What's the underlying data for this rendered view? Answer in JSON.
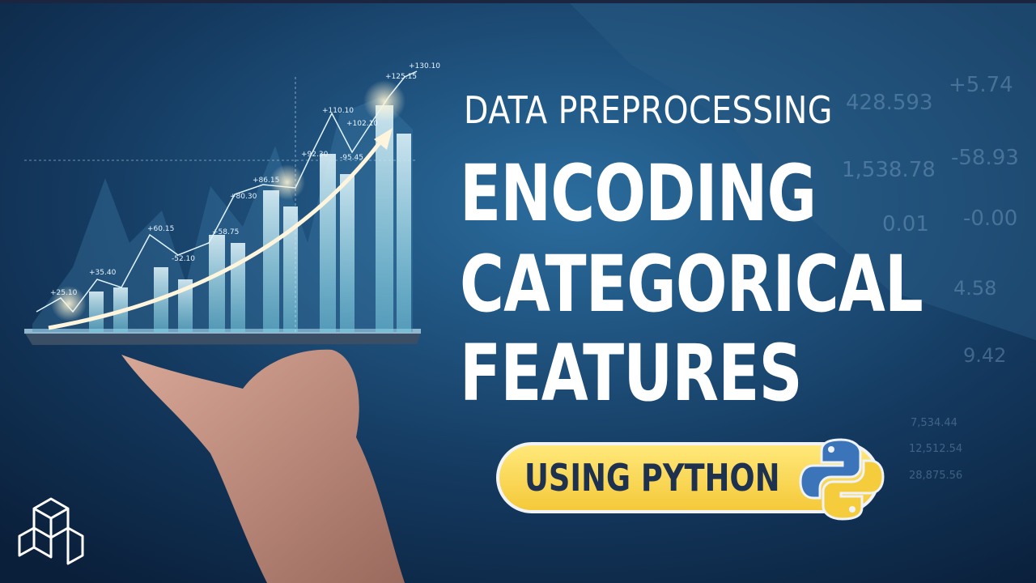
{
  "header": {
    "subtitle": "DATA PREPROCESSING",
    "title_lines": [
      "ENCODING",
      "CATEGORICAL",
      "FEATURES"
    ]
  },
  "badge": {
    "label": "USING PYTHON",
    "icon": "python-logo-icon"
  },
  "chart_labels": [
    "+25.10",
    "+35.40",
    "+60.15",
    "-52.10",
    "+58.75",
    "+80.30",
    "+86.15",
    "+92.30",
    "+110.10",
    "-95.45",
    "+102.10",
    "+125.15",
    "+130.10"
  ],
  "background_numbers": [
    "428.593",
    "+5.74",
    "1,538.78",
    "-58.93",
    "0.01",
    "-0.00",
    "7,534.44",
    "12,512.54",
    "28,875.56",
    "4.58",
    "9.42"
  ],
  "colors": {
    "badge_fill": "#f5c93a",
    "badge_text": "#1e3250",
    "title": "#ffffff",
    "background": "#0e2a4a"
  }
}
